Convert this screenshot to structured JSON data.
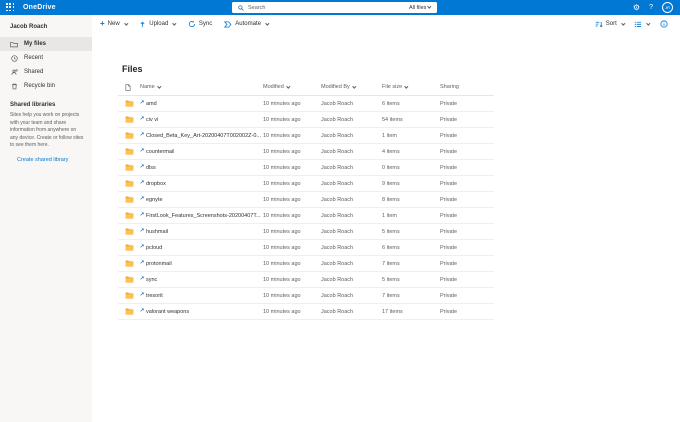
{
  "brand": {
    "app_name": "OneDrive"
  },
  "header": {
    "search_placeholder": "Search",
    "filter_scope": "All files",
    "user_initials": "JR"
  },
  "sidebar": {
    "user_name": "Jacob Roach",
    "items": [
      {
        "label": "My files",
        "selected": true
      },
      {
        "label": "Recent",
        "selected": false
      },
      {
        "label": "Shared",
        "selected": false
      },
      {
        "label": "Recycle bin",
        "selected": false
      }
    ],
    "shared_libraries": {
      "title": "Shared libraries",
      "description": "Sites help you work on projects with your team and share information from anywhere on any device. Create or follow sites to see them here.",
      "link_label": "Create shared library"
    }
  },
  "toolbar": {
    "new_label": "New",
    "upload_label": "Upload",
    "sync_label": "Sync",
    "automate_label": "Automate",
    "sort_label": "Sort"
  },
  "main": {
    "title": "Files",
    "table": {
      "columns": [
        "Name",
        "Modified",
        "Modified By",
        "File size",
        "Sharing"
      ],
      "rows": [
        {
          "name": "amd",
          "modified": "10 minutes ago",
          "modified_by": "Jacob Roach",
          "file_size": "6 items",
          "sharing": "Private"
        },
        {
          "name": "civ vi",
          "modified": "10 minutes ago",
          "modified_by": "Jacob Roach",
          "file_size": "54 items",
          "sharing": "Private"
        },
        {
          "name": "Closed_Beta_Key_Art-20200407T002002Z-0...",
          "modified": "10 minutes ago",
          "modified_by": "Jacob Roach",
          "file_size": "1 item",
          "sharing": "Private"
        },
        {
          "name": "countermail",
          "modified": "10 minutes ago",
          "modified_by": "Jacob Roach",
          "file_size": "4 items",
          "sharing": "Private"
        },
        {
          "name": "dlss",
          "modified": "10 minutes ago",
          "modified_by": "Jacob Roach",
          "file_size": "0 items",
          "sharing": "Private"
        },
        {
          "name": "dropbox",
          "modified": "10 minutes ago",
          "modified_by": "Jacob Roach",
          "file_size": "9 items",
          "sharing": "Private"
        },
        {
          "name": "egnyte",
          "modified": "10 minutes ago",
          "modified_by": "Jacob Roach",
          "file_size": "8 items",
          "sharing": "Private"
        },
        {
          "name": "FirstLook_Features_Screenshots-20200407T...",
          "modified": "10 minutes ago",
          "modified_by": "Jacob Roach",
          "file_size": "1 item",
          "sharing": "Private"
        },
        {
          "name": "hushmail",
          "modified": "10 minutes ago",
          "modified_by": "Jacob Roach",
          "file_size": "5 items",
          "sharing": "Private"
        },
        {
          "name": "pcloud",
          "modified": "10 minutes ago",
          "modified_by": "Jacob Roach",
          "file_size": "6 items",
          "sharing": "Private"
        },
        {
          "name": "protonmail",
          "modified": "10 minutes ago",
          "modified_by": "Jacob Roach",
          "file_size": "7 items",
          "sharing": "Private"
        },
        {
          "name": "sync",
          "modified": "10 minutes ago",
          "modified_by": "Jacob Roach",
          "file_size": "5 items",
          "sharing": "Private"
        },
        {
          "name": "tresorit",
          "modified": "10 minutes ago",
          "modified_by": "Jacob Roach",
          "file_size": "7 items",
          "sharing": "Private"
        },
        {
          "name": "valorant weapons",
          "modified": "10 minutes ago",
          "modified_by": "Jacob Roach",
          "file_size": "17 items",
          "sharing": "Private"
        }
      ]
    }
  },
  "colors": {
    "accent": "#0078d4",
    "folder": "#fdc34f",
    "sidebar_bg": "#f8f7f6",
    "selected_bg": "#e9e7e5"
  }
}
